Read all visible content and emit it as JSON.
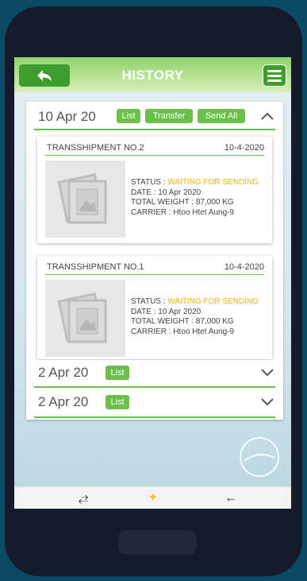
{
  "header": {
    "title": "HISTORY"
  },
  "groups": [
    {
      "date": "10 Apr 20",
      "tags": [
        "List",
        "Transfer",
        "Send All"
      ],
      "expanded": true
    },
    {
      "date": "2 Apr 20",
      "tags": [
        "List"
      ],
      "expanded": false
    },
    {
      "date": "2 Apr 20",
      "tags": [
        "List"
      ],
      "expanded": false
    }
  ],
  "cards": [
    {
      "name": "TRANSSHIPMENT NO.2",
      "date": "10-4-2020",
      "status_label": "STATUS : ",
      "status_value": "WAITING FOR SENDING",
      "date_line": "DATE : 10 Apr 2020",
      "weight_line": "TOTAL WEIGHT : 87,000 KG",
      "carrier_line": "CARRIER : Htoo Htet Aung-9"
    },
    {
      "name": "TRANSSHIPMENT NO.1",
      "date": "10-4-2020",
      "status_label": "STATUS : ",
      "status_value": "WAITING FOR SENDING",
      "date_line": "DATE : 10 Apr 2020",
      "weight_line": "TOTAL WEIGHT : 87,000 KG",
      "carrier_line": "CARRIER : Htoo Htet Aung-9"
    }
  ],
  "colors": {
    "accent": "#6cc04a",
    "status": "#f4b400",
    "bezel": "#151a2c",
    "background": "#0b4a63"
  },
  "icons": {
    "back": "back-arrow-icon",
    "menu": "hamburger-menu-icon",
    "expand": "chevron-down-icon",
    "collapse": "chevron-up-icon"
  }
}
